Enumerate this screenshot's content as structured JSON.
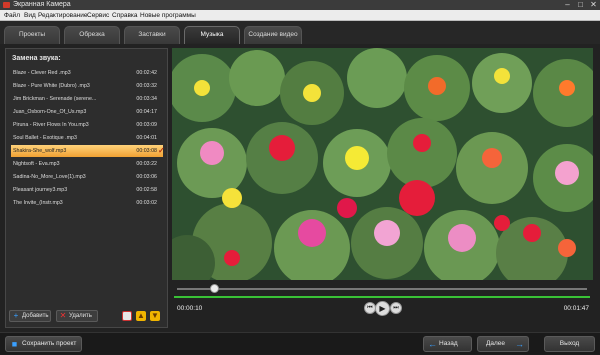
{
  "window": {
    "title": "Экранная Камера",
    "controls": [
      "–",
      "□",
      "✕"
    ]
  },
  "menu": [
    "Файл",
    "Вид",
    "Редактирование",
    "Сервис",
    "Справка",
    "Новые программы"
  ],
  "tabs": [
    "Проекты",
    "Обрезка",
    "Заставки",
    "Музыка",
    "Создание видео"
  ],
  "active_tab": "Музыка",
  "sound_panel": {
    "label": "Замена звука:",
    "tracks": [
      {
        "name": "Blaze - Clever Red .mp3",
        "time": "00:02:42"
      },
      {
        "name": "Blaze - Pure White (Dubro) .mp3",
        "time": "00:03:32"
      },
      {
        "name": "Jim Brickman - Serenade (serene...",
        "time": "00:03:34"
      },
      {
        "name": "Juan_Osborn-One_Of_Us.mp3",
        "time": "00:04:17"
      },
      {
        "name": "Piruna - River Flows In You.mp3",
        "time": "00:03:09"
      },
      {
        "name": "Soul Ballet - Exotique .mp3",
        "time": "00:04:01"
      },
      {
        "name": "Shakira-She_wolf.mp3",
        "time": "00:03:08"
      },
      {
        "name": "Nightsoft - Eva.mp3",
        "time": "00:03:22"
      },
      {
        "name": "Sadina-No_More_Love(1).mp3",
        "time": "00:03:06"
      },
      {
        "name": "Pleasant journey3.mp3",
        "time": "00:02:58"
      },
      {
        "name": "The Invite_(Instr.mp3",
        "time": "00:03:02"
      }
    ],
    "selected_index": 6,
    "add_label": "Добавить",
    "delete_label": "Удалить"
  },
  "player": {
    "current_time": "00:00:10",
    "total_time": "00:01:47",
    "progress_fraction": 0.09
  },
  "bottom": {
    "save_label": "Сохранить проект",
    "back_label": "Назад",
    "next_label": "Далее",
    "exit_label": "Выход"
  },
  "colors": {
    "selected_row": "#f0a133",
    "audio_track": "#39c136",
    "accent_arrow": "#3aa0ff"
  }
}
